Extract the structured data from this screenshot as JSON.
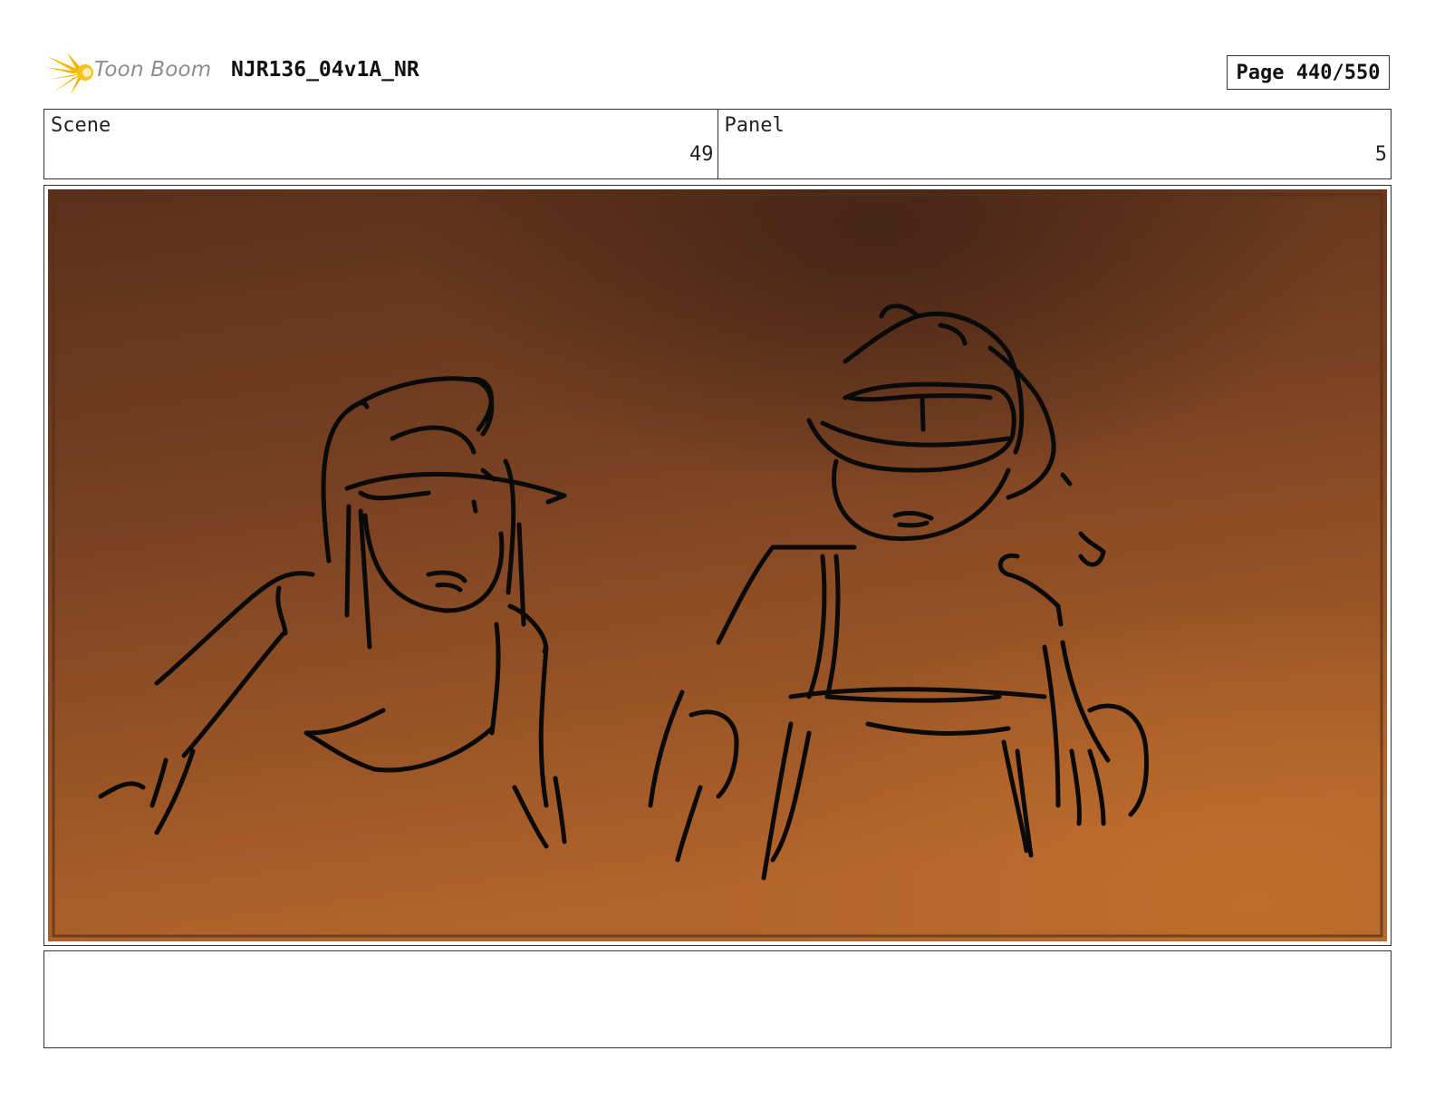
{
  "header": {
    "logo_text": "Toon Boom",
    "project_title": "NJR136_04v1A_NR",
    "page_label": "Page 440/550"
  },
  "info": {
    "scene_label": "Scene",
    "scene_value": "49",
    "panel_label": "Panel",
    "panel_value": "5"
  },
  "panel": {
    "image_description_icon": "storyboard-sketch",
    "colors": {
      "sky_dark": "#4f2a18",
      "sky_mid": "#7a4222",
      "sky_light": "#b9682a",
      "ink": "#0a0a0a"
    }
  },
  "notes": {
    "text": ""
  }
}
